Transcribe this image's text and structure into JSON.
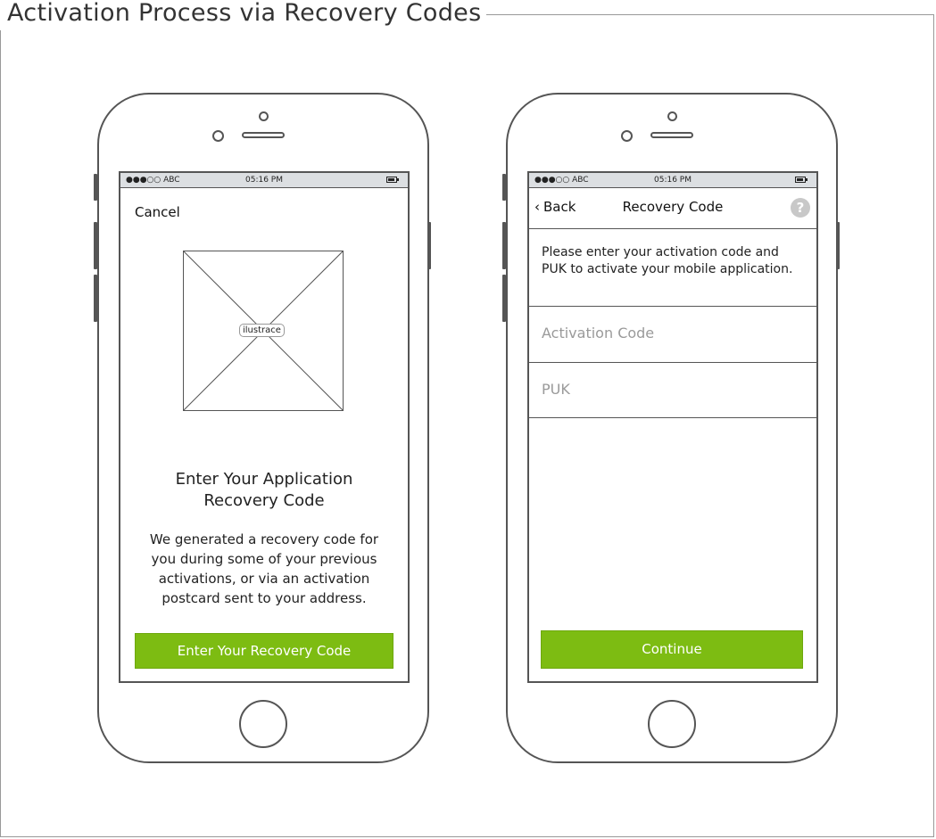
{
  "page": {
    "title": "Activation Process via Recovery Codes"
  },
  "status_bar": {
    "signal": "●●●○○ ABC",
    "time": "05:16 PM"
  },
  "screen_intro": {
    "cancel_label": "Cancel",
    "illustration_label": "ilustrace",
    "heading_line1": "Enter Your Application",
    "heading_line2": "Recovery Code",
    "body_lines": [
      "We generated a recovery code for",
      "you during some of your previous",
      "activations, or via an activation",
      "postcard sent to your address."
    ],
    "cta_label": "Enter Your Recovery Code"
  },
  "screen_form": {
    "back_label": "Back",
    "title": "Recovery Code",
    "help_glyph": "?",
    "instruction_lines": [
      "Please enter your activation code and",
      "PUK to activate your mobile application."
    ],
    "activation_code_placeholder": "Activation Code",
    "puk_placeholder": "PUK",
    "continue_label": "Continue"
  },
  "colors": {
    "accent_green": "#7dbc12",
    "status_bar_bg": "#dcdfe2",
    "placeholder_gray": "#9a9a9a",
    "help_icon_gray": "#c8c8c8"
  }
}
